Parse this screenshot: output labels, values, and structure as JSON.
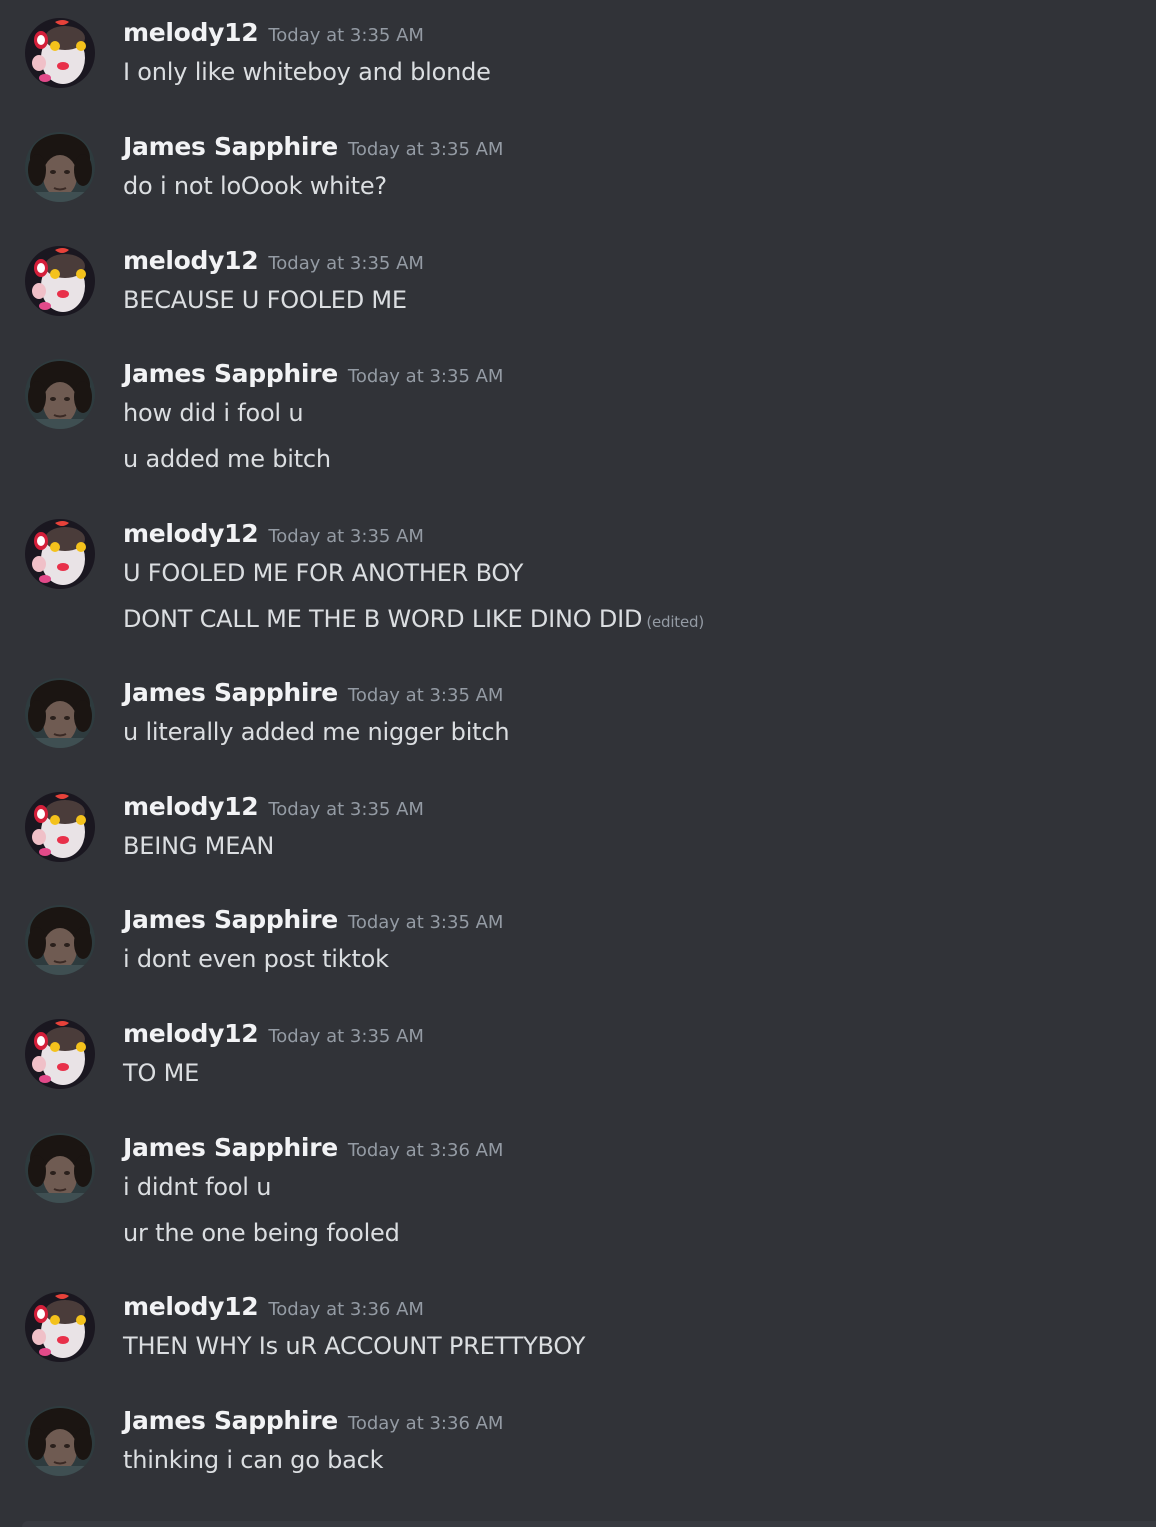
{
  "users": {
    "melody": {
      "name": "melody12",
      "avatar": "melody-avatar-icon"
    },
    "james": {
      "name": "James Sapphire",
      "avatar": "james-avatar-icon"
    }
  },
  "messages": [
    {
      "author": "melody12",
      "timestamp": "Today at 3:35 AM",
      "lines": [
        "I only like whiteboy  and blonde"
      ]
    },
    {
      "author": "James Sapphire",
      "timestamp": "Today at 3:35 AM",
      "lines": [
        "do i not loOook white?"
      ]
    },
    {
      "author": "melody12",
      "timestamp": "Today at 3:35 AM",
      "lines": [
        "BECAUSE U FOOLED ME"
      ]
    },
    {
      "author": "James Sapphire",
      "timestamp": "Today at 3:35 AM",
      "lines": [
        "how did i fool u",
        "u added me bitch"
      ]
    },
    {
      "author": "melody12",
      "timestamp": "Today at 3:35 AM",
      "lines": [
        "U FOOLED ME FOR ANOTHER BOY",
        "DONT CALL ME THE B WORD LIKE DINO DID"
      ],
      "edited_label": "(edited)"
    },
    {
      "author": "James Sapphire",
      "timestamp": "Today at 3:35 AM",
      "lines": [
        "u literally added me nigger bitch"
      ]
    },
    {
      "author": "melody12",
      "timestamp": "Today at 3:35 AM",
      "lines": [
        "BEING MEAN"
      ]
    },
    {
      "author": "James Sapphire",
      "timestamp": "Today at 3:35 AM",
      "lines": [
        "i dont even post tiktok"
      ]
    },
    {
      "author": "melody12",
      "timestamp": "Today at 3:35 AM",
      "lines": [
        "TO ME"
      ]
    },
    {
      "author": "James Sapphire",
      "timestamp": "Today at 3:36 AM",
      "lines": [
        "i didnt fool u",
        "ur the one being fooled"
      ]
    },
    {
      "author": "melody12",
      "timestamp": "Today at 3:36 AM",
      "lines": [
        "THEN WHY Is uR ACCOUNT PRETTYBOY"
      ]
    },
    {
      "author": "James Sapphire",
      "timestamp": "Today at 3:36 AM",
      "lines": [
        "thinking i can go back"
      ]
    }
  ],
  "colors": {
    "background": "#313338",
    "username": "#f2f3f5",
    "timestamp": "#949ba4",
    "text": "#dbdee1"
  }
}
